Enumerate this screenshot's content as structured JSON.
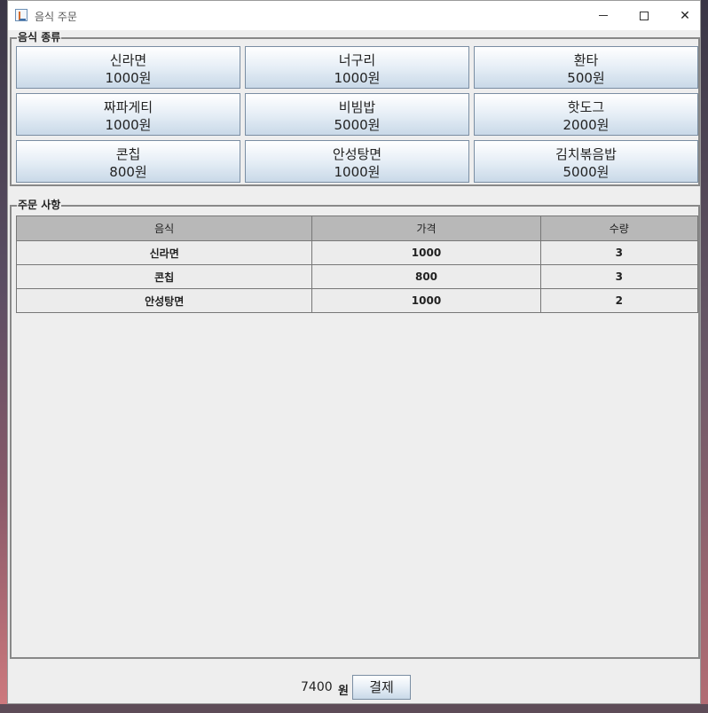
{
  "window": {
    "title": "음식 주문"
  },
  "food_section": {
    "legend": "음식 종류",
    "items": [
      {
        "name": "신라면",
        "price": "1000원"
      },
      {
        "name": "너구리",
        "price": "1000원"
      },
      {
        "name": "환타",
        "price": "500원"
      },
      {
        "name": "짜파게티",
        "price": "1000원"
      },
      {
        "name": "비빔밥",
        "price": "5000원"
      },
      {
        "name": "핫도그",
        "price": "2000원"
      },
      {
        "name": "콘칩",
        "price": "800원"
      },
      {
        "name": "안성탕면",
        "price": "1000원"
      },
      {
        "name": "김치볶음밥",
        "price": "5000원"
      }
    ]
  },
  "order_section": {
    "legend": "주문 사항",
    "columns": [
      "음식",
      "가격",
      "수량"
    ],
    "rows": [
      [
        "신라면",
        "1000",
        "3"
      ],
      [
        "콘칩",
        "800",
        "3"
      ],
      [
        "안성탕면",
        "1000",
        "2"
      ]
    ]
  },
  "footer": {
    "total": "7400",
    "unit": "원",
    "pay_label": "결제"
  }
}
